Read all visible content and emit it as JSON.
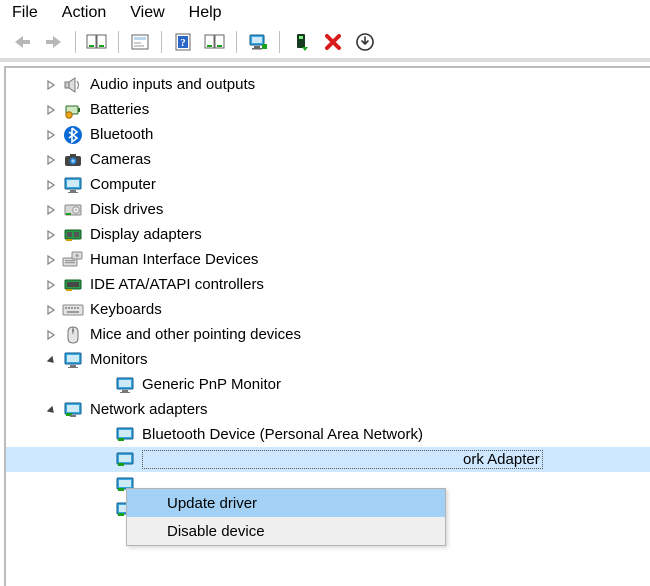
{
  "menubar": {
    "file": "File",
    "action": "Action",
    "view": "View",
    "help": "Help"
  },
  "tree": {
    "audio": "Audio inputs and outputs",
    "batteries": "Batteries",
    "bluetooth": "Bluetooth",
    "cameras": "Cameras",
    "computer": "Computer",
    "disk": "Disk drives",
    "display": "Display adapters",
    "hid": "Human Interface Devices",
    "ide": "IDE ATA/ATAPI controllers",
    "keyboards": "Keyboards",
    "mice": "Mice and other pointing devices",
    "monitors": "Monitors",
    "generic_monitor": "Generic PnP Monitor",
    "netadapters": "Network adapters",
    "net_bt": "Bluetooth Device (Personal Area Network)",
    "net_sel_tail": "ork Adapter"
  },
  "context_menu": {
    "update": "Update driver",
    "disable": "Disable device"
  }
}
